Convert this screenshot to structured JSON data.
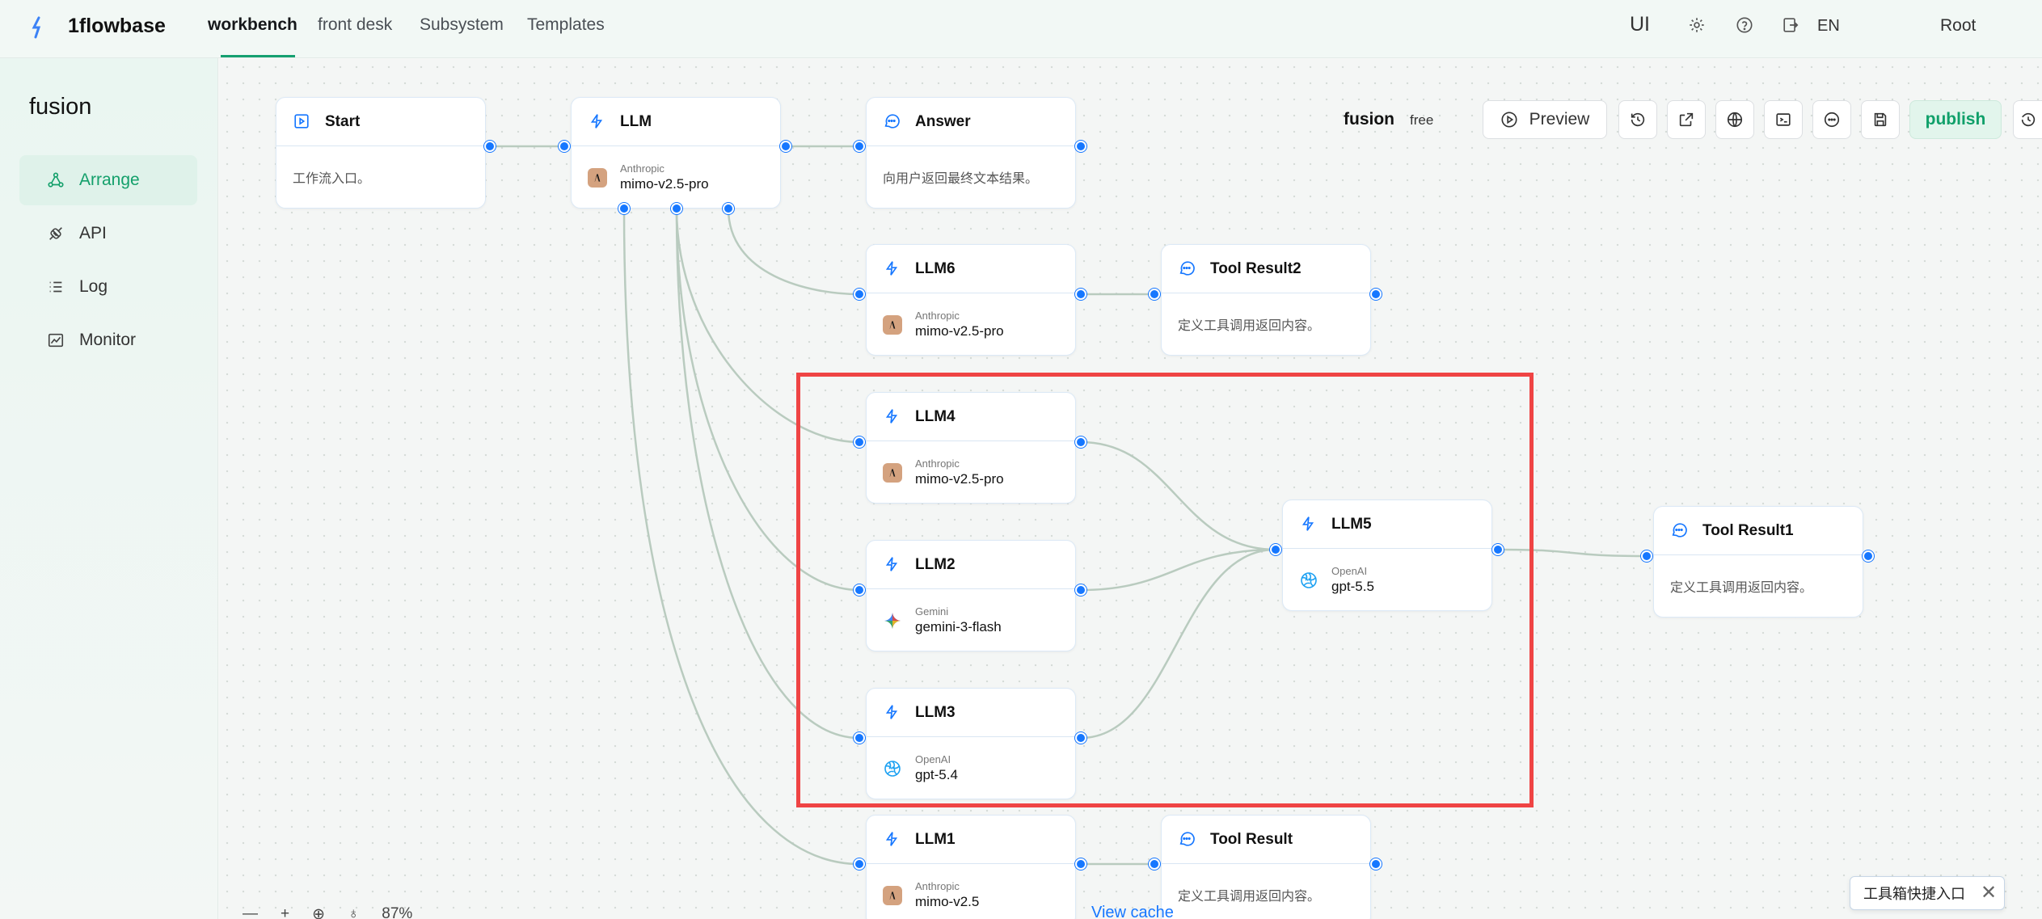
{
  "app": {
    "name": "1flowbase"
  },
  "nav": {
    "tabs": [
      "workbench",
      "front desk",
      "Subsystem",
      "Templates"
    ]
  },
  "topbar": {
    "ui_label": "UI",
    "lang": "EN",
    "user": "Root",
    "icons": [
      "settings-icon",
      "help-icon",
      "export-icon"
    ]
  },
  "sidebar": {
    "title": "fusion",
    "items": [
      {
        "label": "Arrange",
        "icon": "arrange-icon",
        "active": true
      },
      {
        "label": "API",
        "icon": "api-icon"
      },
      {
        "label": "Log",
        "icon": "log-icon"
      },
      {
        "label": "Monitor",
        "icon": "monitor-icon"
      }
    ]
  },
  "workflow": {
    "name": "fusion",
    "badge": "free"
  },
  "toolbar": {
    "preview": "Preview",
    "publish": "publish"
  },
  "nodes": {
    "start": {
      "title": "Start",
      "desc": "工作流入口。"
    },
    "llm": {
      "title": "LLM",
      "provider": "Anthropic",
      "model": "mimo-v2.5-pro"
    },
    "answer": {
      "title": "Answer",
      "desc": "向用户返回最终文本结果。"
    },
    "llm6": {
      "title": "LLM6",
      "provider": "Anthropic",
      "model": "mimo-v2.5-pro"
    },
    "tool_result2": {
      "title": "Tool Result2",
      "desc": "定义工具调用返回内容。"
    },
    "llm4": {
      "title": "LLM4",
      "provider": "Anthropic",
      "model": "mimo-v2.5-pro"
    },
    "llm2": {
      "title": "LLM2",
      "provider": "Gemini",
      "model": "gemini-3-flash"
    },
    "llm3": {
      "title": "LLM3",
      "provider": "OpenAI",
      "model": "gpt-5.4"
    },
    "llm5": {
      "title": "LLM5",
      "provider": "OpenAI",
      "model": "gpt-5.5"
    },
    "tool_result1": {
      "title": "Tool Result1",
      "desc": "定义工具调用返回内容。"
    },
    "llm1": {
      "title": "LLM1",
      "provider": "Anthropic",
      "model": "mimo-v2.5"
    },
    "tool_result": {
      "title": "Tool Result",
      "desc": "定义工具调用返回内容。"
    }
  },
  "bottom": {
    "zoom": "87%",
    "view_cache": "View cache",
    "toolbox_tip": "工具箱快捷入口"
  },
  "colors": {
    "accent": "#14a06b",
    "port": "#1677ff",
    "edge": "#b9cbbf",
    "highlight": "#ef4444"
  }
}
